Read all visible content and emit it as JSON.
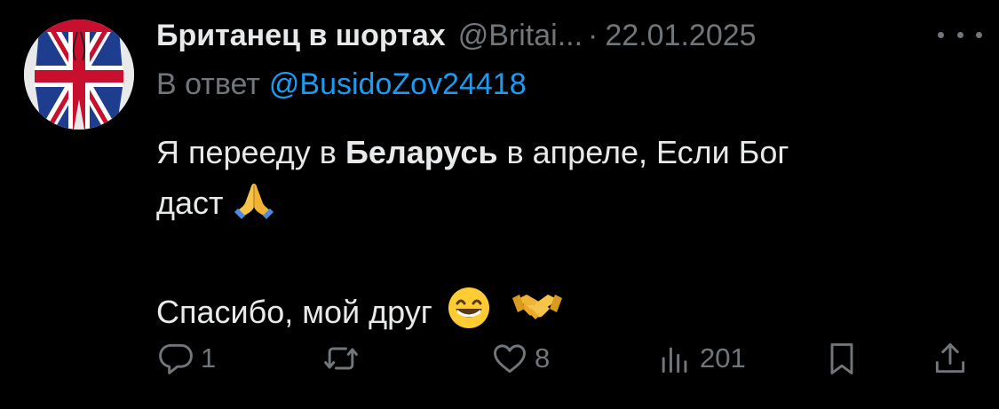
{
  "tweet": {
    "display_name": "Британец в шортах",
    "handle": "@Britai...",
    "separator": "·",
    "date": "22.01.2025",
    "reply_prefix": "В ответ",
    "reply_mention": "@BusidoZov24418",
    "text": {
      "line1_before": "Я перееду в ",
      "line1_bold": "Беларусь",
      "line1_after": " в апреле, Если Бог",
      "line2": "даст",
      "line3": "Спасибо, мой друг"
    },
    "emojis": [
      "folded-hands",
      "grinning-face",
      "handshake"
    ]
  },
  "actions": {
    "replies": "1",
    "reposts": "",
    "likes": "8",
    "views": "201"
  },
  "colors": {
    "background": "#000000",
    "text": "#e7e9ea",
    "secondary": "#71767b",
    "link": "#1d9bf0"
  }
}
